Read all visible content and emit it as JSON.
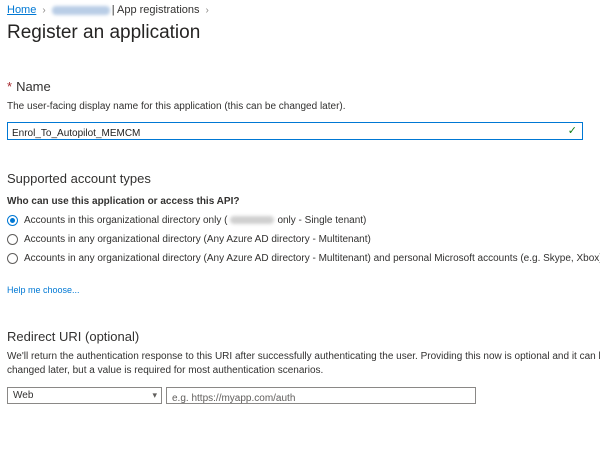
{
  "breadcrumb": {
    "home": "Home",
    "app_registrations": "| App registrations"
  },
  "page_title": "Register an application",
  "name_section": {
    "required_marker": "*",
    "heading": "Name",
    "description": "The user-facing display name for this application (this can be changed later).",
    "value": "Enrol_To_Autopilot_MEMCM"
  },
  "account_types": {
    "heading": "Supported account types",
    "question": "Who can use this application or access this API?",
    "options": [
      {
        "label_before": "Accounts in this organizational directory only (",
        "label_after": "only - Single tenant)",
        "selected": true
      },
      {
        "label": "Accounts in any organizational directory (Any Azure AD directory - Multitenant)",
        "selected": false
      },
      {
        "label": "Accounts in any organizational directory (Any Azure AD directory - Multitenant) and personal Microsoft accounts (e.g. Skype, Xbox)",
        "selected": false
      }
    ],
    "help_link": "Help me choose..."
  },
  "redirect": {
    "heading": "Redirect URI (optional)",
    "description_line1": "We'll return the authentication response to this URI after successfully authenticating the user. Providing this now is optional and it can be",
    "description_line2": "changed later, but a value is required for most authentication scenarios.",
    "platform_value": "Web",
    "uri_placeholder": "e.g. https://myapp.com/auth"
  },
  "colors": {
    "accent": "#0078d4",
    "required": "#a4262c",
    "valid_check": "#107c10"
  }
}
